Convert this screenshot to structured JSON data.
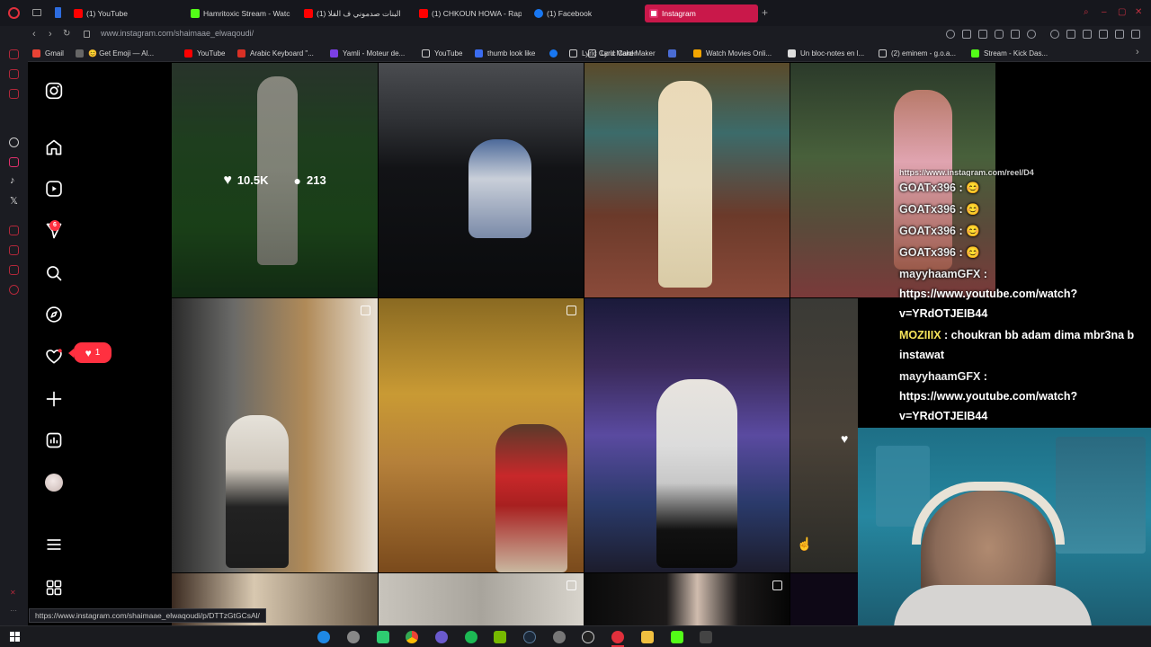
{
  "browser": {
    "tabs": [
      {
        "label": "(1) YouTube",
        "color": "#ff0000"
      },
      {
        "label": "Hamritoxic Stream - Watc",
        "color": "#53fc18"
      },
      {
        "label": "(1) البنات صدموني ف الفلا",
        "color": "#ff0000"
      },
      {
        "label": "(1) CHKOUN HOWA - Rap",
        "color": "#ff0000"
      },
      {
        "label": "(1) Facebook",
        "color": "#1877f2"
      },
      {
        "label": "Instagram",
        "color": "#e1306c"
      }
    ],
    "new_tab_label": "+",
    "url": "www.instagram.com/shaimaae_elwaqoudi/",
    "bookmarks": [
      {
        "label": "Gmail",
        "color": "#ea4335"
      },
      {
        "label": "😊 Get Emoji — Al...",
        "color": "#f4b400"
      },
      {
        "label": "YouTube",
        "color": "#ff0000"
      },
      {
        "label": "Arabic Keyboard \"...",
        "color": "#d93025"
      },
      {
        "label": "Yamli - Moteur de...",
        "color": "#7b3fe4"
      },
      {
        "label": "YouTube",
        "color": "#cccccc"
      },
      {
        "label": "thumb look like",
        "color": "#3b6cf0"
      },
      {
        "label": "",
        "color": "#1877f2"
      },
      {
        "label": "Lyric Card Maker",
        "color": "#cccccc"
      },
      {
        "label": "",
        "color": "#4a6cd4"
      },
      {
        "label": "Watch Movies Onli...",
        "color": "#f2a400"
      },
      {
        "label": "Un bloc-notes en l...",
        "color": "#dddddd"
      },
      {
        "label": "(2) eminem - g.o.a...",
        "color": "#cccccc"
      },
      {
        "label": "Stream - Kick Das...",
        "color": "#53fc18"
      }
    ],
    "status_url": "https://www.instagram.com/shaimaae_elwaqoudi/p/DTTzGtGCsAl/"
  },
  "sidebar": {
    "notification_count": "6",
    "like_popup_count": "1"
  },
  "grid": {
    "hover_likes": "10.5K",
    "hover_comments": "213"
  },
  "chat": [
    {
      "user": "",
      "text": "https://www.instagram.com/reel/D4",
      "cls": "u-white"
    },
    {
      "user": "GOATx396",
      "text": " : 😊",
      "cls": "u-white"
    },
    {
      "user": "GOATx396",
      "text": " : 😊",
      "cls": "u-white"
    },
    {
      "user": "GOATx396",
      "text": " : 😊",
      "cls": "u-white"
    },
    {
      "user": "GOATx396",
      "text": " : 😊",
      "cls": "u-white"
    },
    {
      "user": "mayyhaamGFX",
      "text": " : https://www.youtube.com/watch?v=YRdOTJEIB44",
      "cls": "u-white"
    },
    {
      "user": "MOZIIIX",
      "text": " : choukran bb adam dima mbr3na b instawat",
      "cls": "u-yellow"
    },
    {
      "user": "mayyhaamGFX",
      "text": " : https://www.youtube.com/watch?v=YRdOTJEIB44",
      "cls": "u-white"
    }
  ],
  "colors": {
    "accent": "#ff3040",
    "browser_bg": "#1b1c22",
    "active_tab": "#c9184a"
  }
}
